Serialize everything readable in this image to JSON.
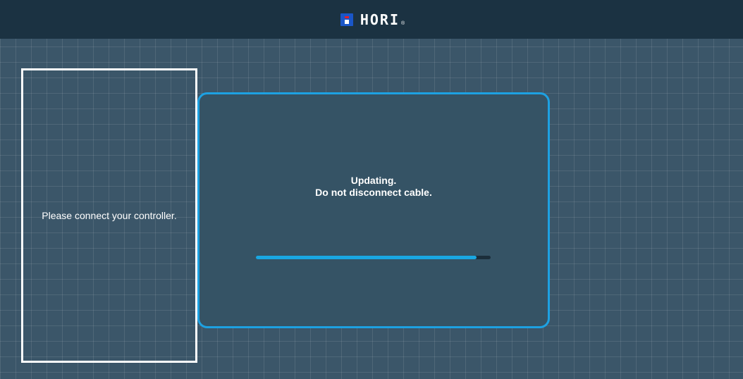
{
  "header": {
    "logo_text": "HORI",
    "logo_reg": "®"
  },
  "left_panel": {
    "message": "Please connect your controller."
  },
  "update_panel": {
    "line1": "Updating.",
    "line2": "Do not disconnect cable.",
    "progress_fraction": 0.94
  },
  "colors": {
    "accent": "#1da1e2",
    "header_bg": "#1b3242",
    "background": "#3b5669"
  }
}
